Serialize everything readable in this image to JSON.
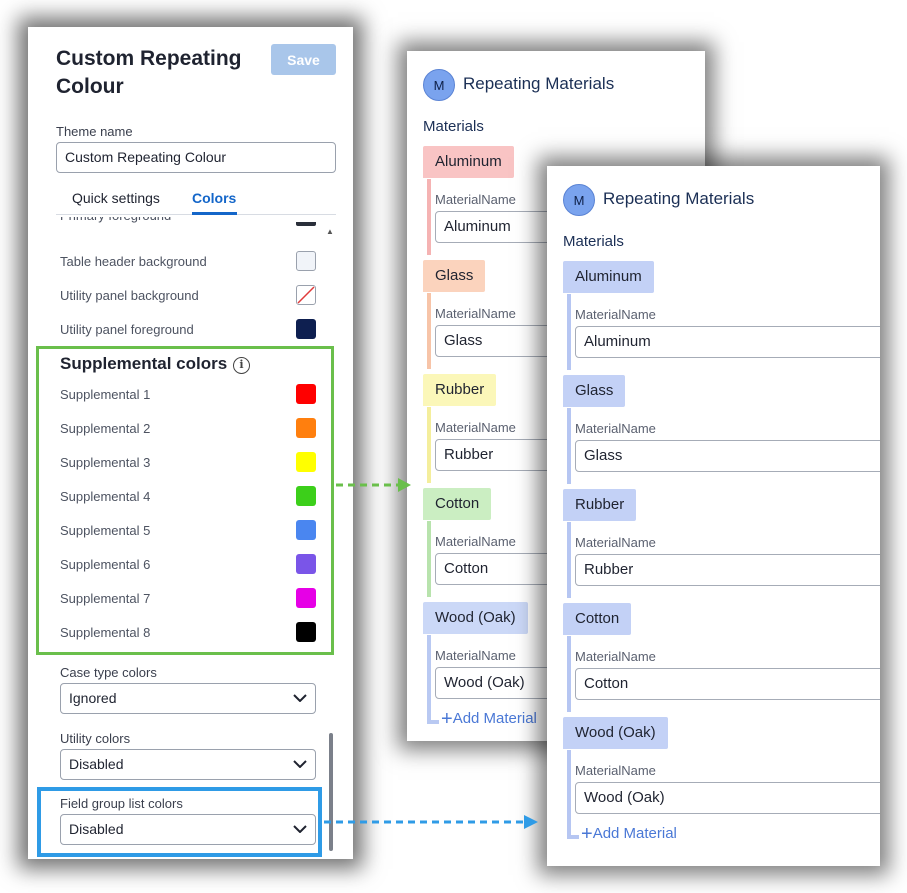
{
  "settings_panel": {
    "title": "Custom Repeating Colour",
    "save_label": "Save",
    "theme_name_label": "Theme name",
    "theme_name_value": "Custom Repeating Colour",
    "tabs": [
      "Quick settings",
      "Colors"
    ],
    "active_tab": "Colors",
    "color_rows": [
      {
        "label": "Table header background",
        "color": "#f1f4f9",
        "outlined": true
      },
      {
        "label": "Utility panel background",
        "color": "none",
        "outlined": true
      },
      {
        "label": "Utility panel foreground",
        "color": "#0e1f50",
        "outlined": false
      }
    ],
    "supplemental": {
      "title": "Supplemental colors",
      "items": [
        {
          "label": "Supplemental 1",
          "color": "#ff0000"
        },
        {
          "label": "Supplemental 2",
          "color": "#ff7f0e"
        },
        {
          "label": "Supplemental 3",
          "color": "#ffff00"
        },
        {
          "label": "Supplemental 4",
          "color": "#3ccf1a"
        },
        {
          "label": "Supplemental 5",
          "color": "#4a86f0"
        },
        {
          "label": "Supplemental 6",
          "color": "#7a55e8"
        },
        {
          "label": "Supplemental 7",
          "color": "#e600e6"
        },
        {
          "label": "Supplemental 8",
          "color": "#000000"
        }
      ]
    },
    "case_type_colors": {
      "label": "Case type colors",
      "value": "Ignored"
    },
    "utility_colors": {
      "label": "Utility colors",
      "value": "Disabled"
    },
    "field_group_list_colors": {
      "label": "Field group list colors",
      "value": "Disabled"
    }
  },
  "card_back": {
    "avatar": "M",
    "title": "Repeating Materials",
    "heading": "Materials",
    "field_label": "MaterialName",
    "add_label": "Add Material",
    "groups": [
      {
        "name": "Aluminum",
        "value": "Aluminum",
        "color": "#f9c4c4",
        "rail": "#f5b3b3"
      },
      {
        "name": "Glass",
        "value": "Glass",
        "color": "#fbd3bd",
        "rail": "#f7c4a8"
      },
      {
        "name": "Rubber",
        "value": "Rubber",
        "color": "#fbf7b9",
        "rail": "#f4ee9c"
      },
      {
        "name": "Cotton",
        "value": "Cotton",
        "color": "#cbeec2",
        "rail": "#b8e3ad"
      },
      {
        "name": "Wood (Oak)",
        "value": "Wood (Oak)",
        "color": "#cbd8f7",
        "rail": "#b9c9f2"
      }
    ]
  },
  "card_front": {
    "avatar": "M",
    "title": "Repeating Materials",
    "heading": "Materials",
    "field_label": "MaterialName",
    "add_label": "Add Material",
    "groups": [
      {
        "name": "Aluminum",
        "value": "Aluminum",
        "color": "#c3d1f6",
        "rail": "#b6c6f2"
      },
      {
        "name": "Glass",
        "value": "Glass",
        "color": "#c3d1f6",
        "rail": "#b6c6f2"
      },
      {
        "name": "Rubber",
        "value": "Rubber",
        "color": "#c3d1f6",
        "rail": "#b6c6f2"
      },
      {
        "name": "Cotton",
        "value": "Cotton",
        "color": "#c3d1f6",
        "rail": "#b6c6f2"
      },
      {
        "name": "Wood (Oak)",
        "value": "Wood (Oak)",
        "color": "#c3d1f6",
        "rail": "#b6c6f2"
      }
    ]
  },
  "highlight_colors": {
    "supplemental": "#6abf4b",
    "field_group": "#2f9be6"
  }
}
